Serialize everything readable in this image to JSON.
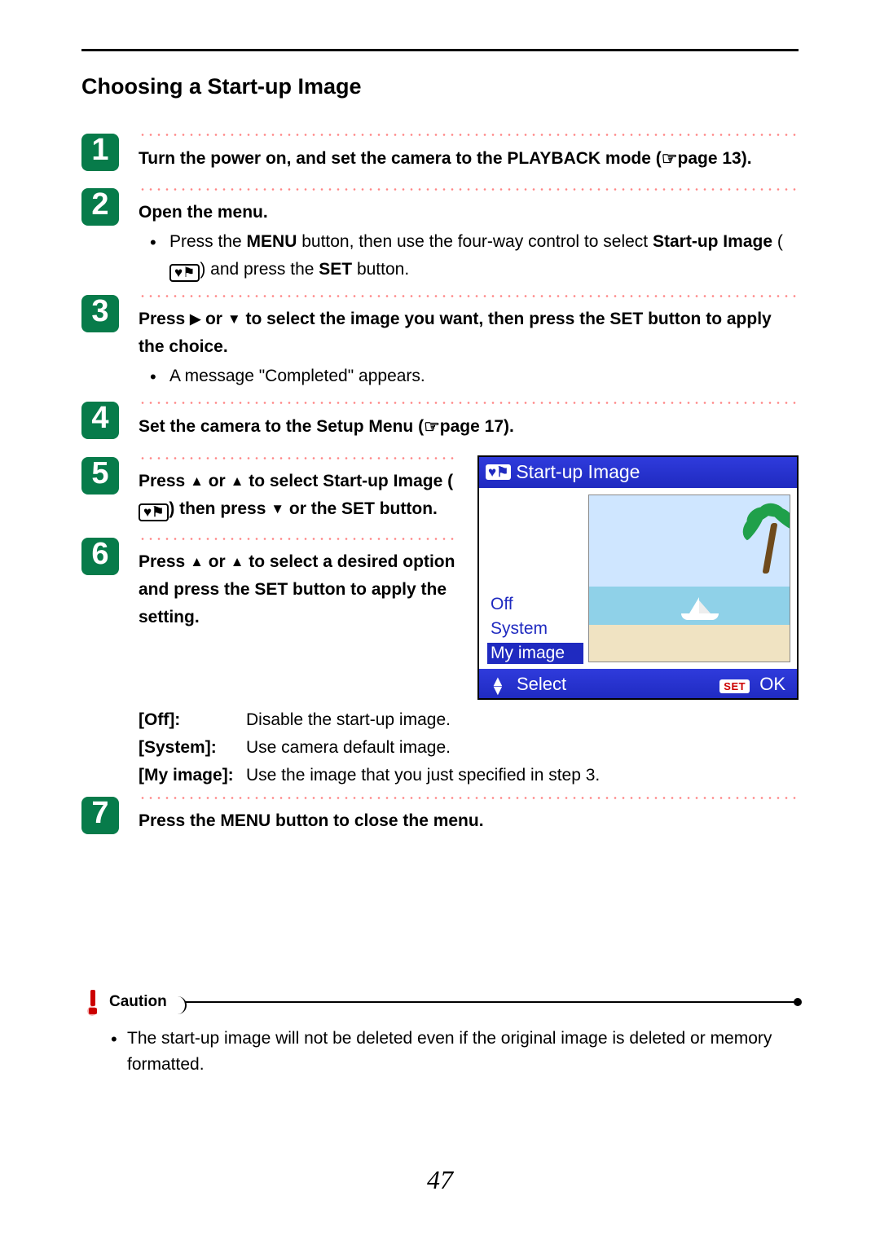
{
  "section_title": "Choosing a Start-up Image",
  "icons": {
    "pointer": "☞",
    "heart_flag": "♥⚑",
    "tri_right": "▶",
    "tri_down": "▼",
    "tri_up": "▲"
  },
  "steps": [
    {
      "num": "1",
      "lead_parts": {
        "a": "Turn the power on, and set the camera to the PLAYBACK mode (",
        "b": "page 13)."
      }
    },
    {
      "num": "2",
      "lead": "Open the menu.",
      "bullet_parts": {
        "a": "Press the ",
        "menu": "MENU",
        "b": " button, then use the four-way control to select ",
        "startup": "Start-up Image",
        "c": " (",
        "d": ") and press the ",
        "set": "SET",
        "e": " button."
      }
    },
    {
      "num": "3",
      "lead_parts": {
        "a": "Press ",
        "b": " or ",
        "c": " to select the image you want, then press the SET button to apply the choice."
      },
      "bullet": "A message \"Completed\" appears."
    },
    {
      "num": "4",
      "lead_parts": {
        "a": "Set the camera to the Setup Menu (",
        "b": "page 17)."
      }
    },
    {
      "num": "5",
      "lead_parts": {
        "a": "Press ",
        "b": " or ",
        "c": " to select Start-up Image (",
        "d": ") then press ",
        "e": " or the SET button."
      }
    },
    {
      "num": "6",
      "lead_parts": {
        "a": "Press ",
        "b": " or ",
        "c": " to select a desired option and press the SET button to apply the setting."
      },
      "options": [
        {
          "k": "[Off]:",
          "v": "Disable the start-up image."
        },
        {
          "k": "[System]:",
          "v": "Use camera default image."
        },
        {
          "k": "[My image]:",
          "v": "Use the image that you just specified in step 3."
        }
      ]
    },
    {
      "num": "7",
      "lead": "Press the MENU button to close the menu."
    }
  ],
  "lcd": {
    "title": "Start-up Image",
    "options": [
      "Off",
      "System",
      "My image"
    ],
    "selected_index": 2,
    "footer_select": "Select",
    "footer_set": "SET",
    "footer_ok": "OK"
  },
  "caution": {
    "label": "Caution",
    "text": "The start-up image will not be deleted even if the original image is deleted or memory formatted."
  },
  "page_number": "47"
}
